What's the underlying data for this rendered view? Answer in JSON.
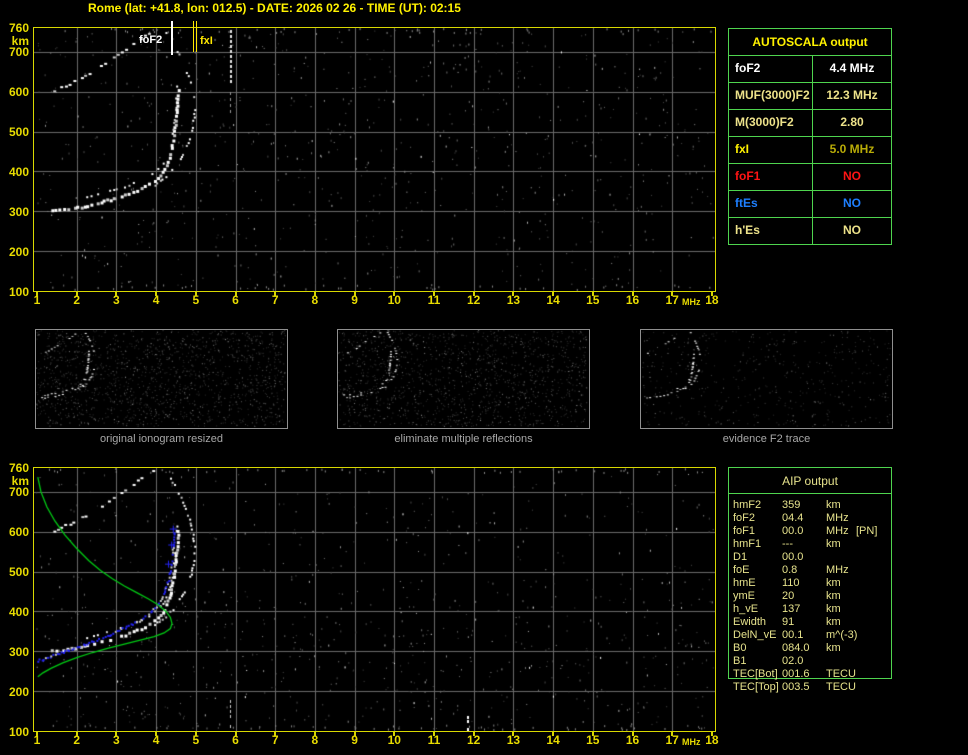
{
  "window": {
    "title": "Rome (lat: +41.8, lon: 012.5) - DATE: 2026 02 26 - TIME (UT): 02:15"
  },
  "axes": {
    "x_unit": "MHz",
    "y_unit": "km",
    "x_ticks": [
      "1",
      "2",
      "3",
      "4",
      "5",
      "6",
      "7",
      "8",
      "9",
      "10",
      "11",
      "12",
      "13",
      "14",
      "15",
      "16",
      "17",
      "18"
    ],
    "y_ticks": [
      "760",
      "700",
      "600",
      "500",
      "400",
      "300",
      "200",
      "100"
    ],
    "x_range": [
      1,
      18
    ],
    "y_range": [
      100,
      760
    ]
  },
  "autoscala": {
    "header": "AUTOSCALA output",
    "rows": [
      {
        "label": "foF2",
        "value": "4.4 MHz",
        "label_color": "#FFFFFF",
        "value_color": "#FFFFFF"
      },
      {
        "label": "MUF(3000)F2",
        "value": "12.3 MHz",
        "label_color": "#EDE28A",
        "value_color": "#EDE28A"
      },
      {
        "label": "M(3000)F2",
        "value": "2.80",
        "label_color": "#EDE28A",
        "value_color": "#EDE28A"
      },
      {
        "label": "fxI",
        "value": "5.0 MHz",
        "label_color": "#FFF200",
        "value_color": "#B9AC07"
      },
      {
        "label": "foF1",
        "value": "NO",
        "label_color": "#FF1414",
        "value_color": "#FF1414"
      },
      {
        "label": "ftEs",
        "value": "NO",
        "label_color": "#1E7FFF",
        "value_color": "#1E7FFF"
      },
      {
        "label": "h'Es",
        "value": "NO",
        "label_color": "#EDE28A",
        "value_color": "#EDE28A"
      }
    ]
  },
  "thumbnails": [
    {
      "caption": "original ionogram resized"
    },
    {
      "caption": "eliminate multiple reflections"
    },
    {
      "caption": "evidence F2 trace"
    }
  ],
  "aip": {
    "header": "AIP output",
    "rows": [
      {
        "name": "hmF2",
        "value": "359",
        "unit": "km",
        "note": ""
      },
      {
        "name": "foF2",
        "value": "04.4",
        "unit": "MHz",
        "note": ""
      },
      {
        "name": "foF1",
        "value": "00.0",
        "unit": "MHz",
        "note": "[PN]"
      },
      {
        "name": "hmF1",
        "value": "---",
        "unit": "km",
        "note": ""
      },
      {
        "name": "D1",
        "value": "00.0",
        "unit": "",
        "note": ""
      },
      {
        "name": "foE",
        "value": "0.8",
        "unit": "MHz",
        "note": ""
      },
      {
        "name": "hmE",
        "value": "110",
        "unit": "km",
        "note": ""
      },
      {
        "name": "ymE",
        "value": "20",
        "unit": "km",
        "note": ""
      },
      {
        "name": "h_vE",
        "value": "137",
        "unit": "km",
        "note": ""
      },
      {
        "name": "Ewidth",
        "value": "91",
        "unit": "km",
        "note": ""
      },
      {
        "name": "DelN_vE",
        "value": "00.1",
        "unit": "m^(-3)",
        "note": ""
      },
      {
        "name": "B0",
        "value": "084.0",
        "unit": "km",
        "note": ""
      },
      {
        "name": "B1",
        "value": "02.0",
        "unit": "",
        "note": ""
      },
      {
        "name": "TEC[Bot]",
        "value": "001.6",
        "unit": "TECU",
        "note": ""
      },
      {
        "name": "TEC[Top]",
        "value": "003.5",
        "unit": "TECU",
        "note": ""
      }
    ]
  },
  "chart_data": [
    {
      "type": "scatter",
      "name": "ionogram-top",
      "title": "recorded ionogram with autoscaled characteristics",
      "xlabel": "MHz",
      "ylabel": "km",
      "x_range": [
        1,
        18
      ],
      "y_range": [
        100,
        760
      ],
      "grid": true,
      "markers": [
        {
          "label": "foF2",
          "freq_mhz": 4.4,
          "color": "#FFFFFF"
        },
        {
          "label": "fxI",
          "freq_mhz": 5.0,
          "color": "#FFE800"
        }
      ],
      "series": [
        {
          "name": "F2 trace 1st hop",
          "color": "#FFFFFF",
          "points": [
            [
              1.35,
              305
            ],
            [
              1.55,
              305
            ],
            [
              1.75,
              308
            ],
            [
              2.0,
              312
            ],
            [
              2.25,
              317
            ],
            [
              2.5,
              323
            ],
            [
              2.75,
              330
            ],
            [
              3.0,
              337
            ],
            [
              3.2,
              344
            ],
            [
              3.4,
              352
            ],
            [
              3.6,
              360
            ],
            [
              3.8,
              370
            ],
            [
              3.95,
              380
            ],
            [
              4.1,
              393
            ],
            [
              4.2,
              408
            ],
            [
              4.28,
              428
            ],
            [
              4.35,
              452
            ],
            [
              4.4,
              478
            ],
            [
              4.44,
              505
            ],
            [
              4.47,
              535
            ],
            [
              4.5,
              565
            ],
            [
              4.52,
              595
            ],
            [
              4.54,
              615
            ]
          ]
        },
        {
          "name": "F2 trace 2nd hop",
          "color": "#FFFFFF",
          "points": [
            [
              1.4,
              605
            ],
            [
              1.6,
              613
            ],
            [
              1.8,
              622
            ],
            [
              2.0,
              632
            ],
            [
              2.2,
              643
            ],
            [
              2.4,
              655
            ],
            [
              2.6,
              667
            ],
            [
              2.8,
              680
            ],
            [
              3.0,
              694
            ],
            [
              3.2,
              708
            ],
            [
              3.4,
              722
            ],
            [
              3.6,
              736
            ],
            [
              3.8,
              748
            ],
            [
              4.0,
              757
            ]
          ]
        },
        {
          "name": "x-mode arc",
          "color": "#FFFFFF",
          "points": [
            [
              3.95,
              368
            ],
            [
              4.15,
              382
            ],
            [
              4.35,
              400
            ],
            [
              4.55,
              425
            ],
            [
              4.7,
              452
            ],
            [
              4.82,
              482
            ],
            [
              4.9,
              512
            ],
            [
              4.94,
              540
            ],
            [
              4.95,
              565
            ],
            [
              4.92,
              595
            ],
            [
              4.85,
              625
            ],
            [
              4.74,
              658
            ],
            [
              4.6,
              690
            ],
            [
              4.45,
              718
            ],
            [
              4.3,
              742
            ],
            [
              4.18,
              757
            ]
          ]
        }
      ]
    },
    {
      "type": "scatter",
      "name": "ionogram-bottom-with-profile",
      "title": "ionogram with autoscaled trace and electron density profile",
      "xlabel": "MHz",
      "ylabel": "km",
      "x_range": [
        1,
        18
      ],
      "y_range": [
        100,
        760
      ],
      "grid": true,
      "series": [
        {
          "name": "F2 trace 1st hop",
          "color": "#FFFFFF",
          "points": [
            [
              1.35,
              305
            ],
            [
              1.55,
              305
            ],
            [
              1.75,
              308
            ],
            [
              2.0,
              312
            ],
            [
              2.25,
              317
            ],
            [
              2.5,
              323
            ],
            [
              2.75,
              330
            ],
            [
              3.0,
              337
            ],
            [
              3.2,
              344
            ],
            [
              3.4,
              352
            ],
            [
              3.6,
              360
            ],
            [
              3.8,
              370
            ],
            [
              3.95,
              380
            ],
            [
              4.1,
              393
            ],
            [
              4.2,
              408
            ],
            [
              4.28,
              428
            ],
            [
              4.35,
              452
            ],
            [
              4.4,
              478
            ],
            [
              4.44,
              505
            ],
            [
              4.47,
              535
            ],
            [
              4.5,
              565
            ],
            [
              4.52,
              595
            ],
            [
              4.54,
              615
            ]
          ]
        },
        {
          "name": "F2 trace 2nd hop",
          "color": "#FFFFFF",
          "points": [
            [
              1.4,
              605
            ],
            [
              1.6,
              613
            ],
            [
              1.8,
              622
            ],
            [
              2.0,
              632
            ],
            [
              2.2,
              643
            ],
            [
              2.4,
              655
            ],
            [
              2.6,
              667
            ],
            [
              2.8,
              680
            ],
            [
              3.0,
              694
            ],
            [
              3.2,
              708
            ],
            [
              3.4,
              722
            ],
            [
              3.6,
              736
            ],
            [
              3.8,
              748
            ],
            [
              4.0,
              757
            ]
          ]
        },
        {
          "name": "x-mode arc",
          "color": "#FFFFFF",
          "points": [
            [
              3.95,
              368
            ],
            [
              4.15,
              382
            ],
            [
              4.35,
              400
            ],
            [
              4.55,
              425
            ],
            [
              4.7,
              452
            ],
            [
              4.82,
              482
            ],
            [
              4.9,
              512
            ],
            [
              4.94,
              540
            ],
            [
              4.95,
              565
            ],
            [
              4.92,
              595
            ],
            [
              4.85,
              625
            ],
            [
              4.74,
              658
            ],
            [
              4.6,
              690
            ],
            [
              4.45,
              718
            ],
            [
              4.3,
              742
            ],
            [
              4.18,
              757
            ]
          ]
        },
        {
          "name": "autoscaled F2 trace",
          "color": "#2323F0",
          "points": [
            [
              1.0,
              278
            ],
            [
              1.3,
              288
            ],
            [
              1.6,
              298
            ],
            [
              1.9,
              308
            ],
            [
              2.2,
              319
            ],
            [
              2.5,
              331
            ],
            [
              2.8,
              343
            ],
            [
              3.1,
              356
            ],
            [
              3.35,
              368
            ],
            [
              3.6,
              381
            ],
            [
              3.8,
              395
            ],
            [
              3.95,
              410
            ],
            [
              4.1,
              428
            ],
            [
              4.2,
              450
            ],
            [
              4.28,
              475
            ],
            [
              4.34,
              500
            ],
            [
              4.38,
              528
            ],
            [
              4.41,
              556
            ],
            [
              4.43,
              582
            ],
            [
              4.45,
              605
            ]
          ]
        },
        {
          "name": "electron density profile",
          "color": "#00CC14",
          "points": [
            [
              1.02,
              737
            ],
            [
              1.1,
              700
            ],
            [
              1.25,
              662
            ],
            [
              1.45,
              627
            ],
            [
              1.7,
              592
            ],
            [
              2.0,
              558
            ],
            [
              2.3,
              528
            ],
            [
              2.6,
              503
            ],
            [
              2.9,
              482
            ],
            [
              3.2,
              464
            ],
            [
              3.5,
              448
            ],
            [
              3.8,
              432
            ],
            [
              4.05,
              417
            ],
            [
              4.25,
              400
            ],
            [
              4.36,
              385
            ],
            [
              4.4,
              370
            ],
            [
              4.36,
              357
            ],
            [
              4.2,
              346
            ],
            [
              3.95,
              337
            ],
            [
              3.6,
              328
            ],
            [
              3.2,
              318
            ],
            [
              2.8,
              308
            ],
            [
              2.4,
              297
            ],
            [
              2.0,
              284
            ],
            [
              1.65,
              271
            ],
            [
              1.35,
              257
            ],
            [
              1.15,
              246
            ],
            [
              1.02,
              236
            ]
          ]
        }
      ]
    }
  ]
}
